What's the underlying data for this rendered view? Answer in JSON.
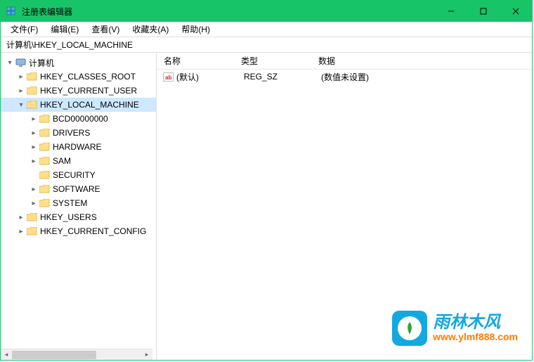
{
  "window": {
    "title": "注册表编辑器"
  },
  "menu": {
    "file": "文件(F)",
    "edit": "编辑(E)",
    "view": "查看(V)",
    "favorites": "收藏夹(A)",
    "help": "帮助(H)"
  },
  "address": "计算机\\HKEY_LOCAL_MACHINE",
  "tree": {
    "root": "计算机",
    "hives": {
      "classes_root": "HKEY_CLASSES_ROOT",
      "current_user": "HKEY_CURRENT_USER",
      "local_machine": "HKEY_LOCAL_MACHINE",
      "users": "HKEY_USERS",
      "current_config": "HKEY_CURRENT_CONFIG"
    },
    "hklm_children": {
      "bcd": "BCD00000000",
      "drivers": "DRIVERS",
      "hardware": "HARDWARE",
      "sam": "SAM",
      "security": "SECURITY",
      "software": "SOFTWARE",
      "system": "SYSTEM"
    }
  },
  "columns": {
    "name": "名称",
    "type": "类型",
    "data": "数据"
  },
  "values": {
    "default": {
      "name": "(默认)",
      "type": "REG_SZ",
      "data": "(数值未设置)"
    }
  },
  "watermark": {
    "title": "雨林木风",
    "url": "www.ylmf888.com"
  }
}
